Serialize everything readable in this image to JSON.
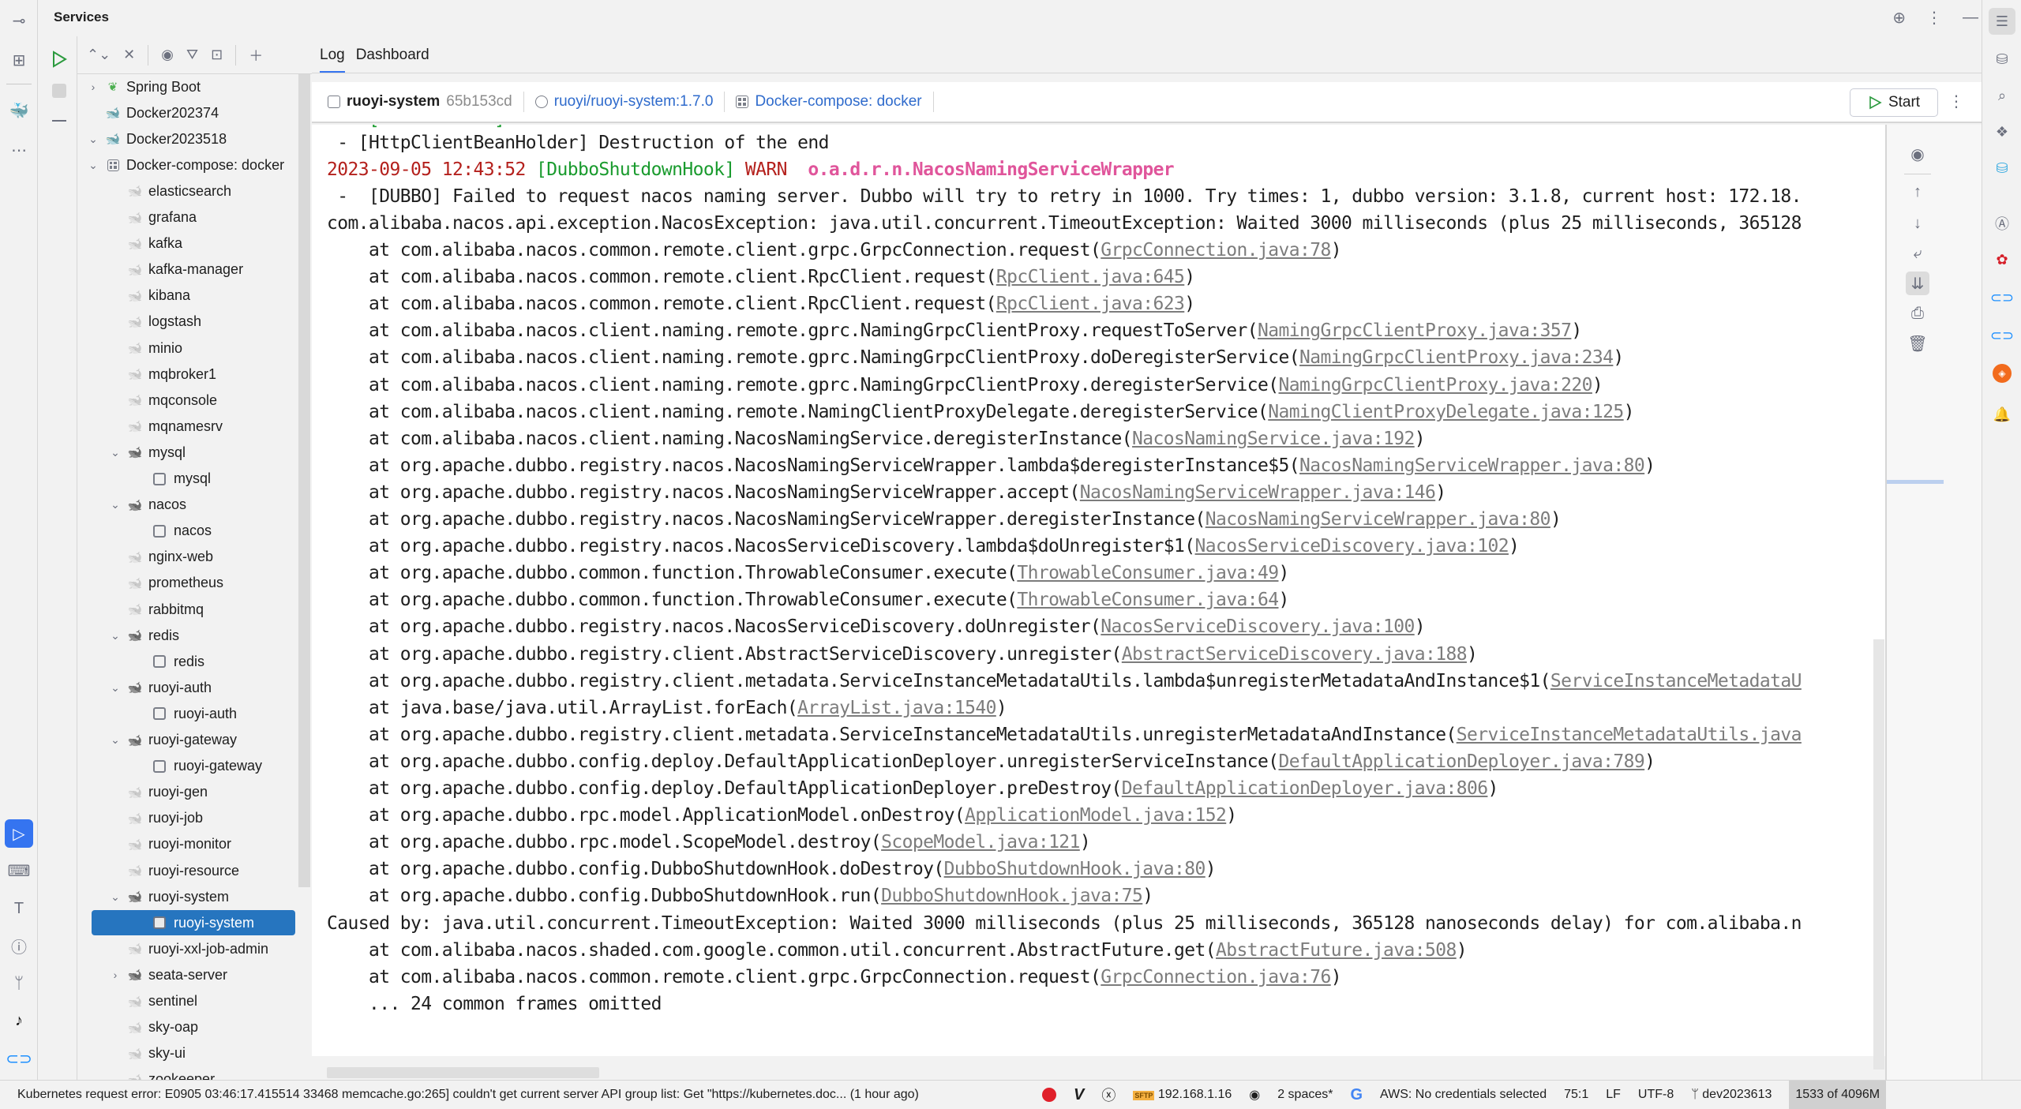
{
  "services": {
    "title": "Services"
  },
  "header_icons": [
    "crosshair-icon",
    "more-icon",
    "minimize-icon"
  ],
  "tree_toolbar": [
    "expand-all-icon",
    "collapse-all-icon",
    "view-options-icon",
    "filter-icon",
    "new-group-icon",
    "add-service-icon"
  ],
  "tree": [
    {
      "label": "Spring Boot",
      "level": 0,
      "chevron": "right",
      "icon": "spring-boot-icon"
    },
    {
      "label": "Docker202374",
      "level": 0,
      "chevron": "",
      "icon": "docker-icon"
    },
    {
      "label": "Docker2023518",
      "level": 0,
      "chevron": "down",
      "icon": "docker-connected-icon"
    },
    {
      "label": "Docker-compose: docker",
      "level": 1,
      "chevron": "down",
      "icon": "compose-icon"
    },
    {
      "label": "elasticsearch",
      "level": 2,
      "chevron": "",
      "icon": "container-idle-icon"
    },
    {
      "label": "grafana",
      "level": 2,
      "chevron": "",
      "icon": "container-idle-icon"
    },
    {
      "label": "kafka",
      "level": 2,
      "chevron": "",
      "icon": "container-idle-icon"
    },
    {
      "label": "kafka-manager",
      "level": 2,
      "chevron": "",
      "icon": "container-idle-icon"
    },
    {
      "label": "kibana",
      "level": 2,
      "chevron": "",
      "icon": "container-idle-icon"
    },
    {
      "label": "logstash",
      "level": 2,
      "chevron": "",
      "icon": "container-idle-icon"
    },
    {
      "label": "minio",
      "level": 2,
      "chevron": "",
      "icon": "container-idle-icon"
    },
    {
      "label": "mqbroker1",
      "level": 2,
      "chevron": "",
      "icon": "container-idle-icon"
    },
    {
      "label": "mqconsole",
      "level": 2,
      "chevron": "",
      "icon": "container-idle-icon"
    },
    {
      "label": "mqnamesrv",
      "level": 2,
      "chevron": "",
      "icon": "container-idle-icon"
    },
    {
      "label": "mysql",
      "level": 2,
      "chevron": "down",
      "icon": "container-service-icon"
    },
    {
      "label": "mysql",
      "level": 3,
      "chevron": "",
      "icon": "container-box-icon"
    },
    {
      "label": "nacos",
      "level": 2,
      "chevron": "down",
      "icon": "container-service-icon"
    },
    {
      "label": "nacos",
      "level": 3,
      "chevron": "",
      "icon": "container-box-icon"
    },
    {
      "label": "nginx-web",
      "level": 2,
      "chevron": "",
      "icon": "container-idle-icon"
    },
    {
      "label": "prometheus",
      "level": 2,
      "chevron": "",
      "icon": "container-idle-icon"
    },
    {
      "label": "rabbitmq",
      "level": 2,
      "chevron": "",
      "icon": "container-idle-icon"
    },
    {
      "label": "redis",
      "level": 2,
      "chevron": "down",
      "icon": "container-service-icon"
    },
    {
      "label": "redis",
      "level": 3,
      "chevron": "",
      "icon": "container-box-icon"
    },
    {
      "label": "ruoyi-auth",
      "level": 2,
      "chevron": "down",
      "icon": "container-service-icon"
    },
    {
      "label": "ruoyi-auth",
      "level": 3,
      "chevron": "",
      "icon": "container-box-icon"
    },
    {
      "label": "ruoyi-gateway",
      "level": 2,
      "chevron": "down",
      "icon": "container-service-icon"
    },
    {
      "label": "ruoyi-gateway",
      "level": 3,
      "chevron": "",
      "icon": "container-box-icon"
    },
    {
      "label": "ruoyi-gen",
      "level": 2,
      "chevron": "",
      "icon": "container-idle-icon"
    },
    {
      "label": "ruoyi-job",
      "level": 2,
      "chevron": "",
      "icon": "container-idle-icon"
    },
    {
      "label": "ruoyi-monitor",
      "level": 2,
      "chevron": "",
      "icon": "container-idle-icon"
    },
    {
      "label": "ruoyi-resource",
      "level": 2,
      "chevron": "",
      "icon": "container-idle-icon"
    },
    {
      "label": "ruoyi-system",
      "level": 2,
      "chevron": "down",
      "icon": "container-service-icon"
    },
    {
      "label": "ruoyi-system",
      "level": 3,
      "chevron": "",
      "icon": "container-box-icon",
      "selected": true
    },
    {
      "label": "ruoyi-xxl-job-admin",
      "level": 2,
      "chevron": "",
      "icon": "container-idle-icon"
    },
    {
      "label": "seata-server",
      "level": 2,
      "chevron": "right",
      "icon": "container-service-icon"
    },
    {
      "label": "sentinel",
      "level": 2,
      "chevron": "",
      "icon": "container-idle-icon"
    },
    {
      "label": "sky-oap",
      "level": 2,
      "chevron": "",
      "icon": "container-idle-icon"
    },
    {
      "label": "sky-ui",
      "level": 2,
      "chevron": "",
      "icon": "container-idle-icon"
    },
    {
      "label": "zookeeper",
      "level": 2,
      "chevron": "",
      "icon": "container-idle-icon"
    }
  ],
  "tabs": [
    {
      "label": "Log",
      "active": true
    },
    {
      "label": "Dashboard",
      "active": false
    }
  ],
  "container_header": {
    "name": "ruoyi-system",
    "id": "65b153cd",
    "image": "ruoyi/ruoyi-system:1.7.0",
    "compose": "Docker-compose: docker",
    "start_label": "Start"
  },
  "log": {
    "top_fragment": " - [HttpClientBeanHolder] Destruction of the end",
    "warn_line": {
      "timestamp": "2023-09-05 12:43:52",
      "thread": "[DubboShutdownHook]",
      "level": "WARN",
      "logger": "o.a.d.r.n.NacosNamingServiceWrapper"
    },
    "message": " -  [DUBBO] Failed to request nacos naming server. Dubbo will try to retry in 1000. Try times: 1, dubbo version: 3.1.8, current host: 172.18.",
    "exception": "com.alibaba.nacos.api.exception.NacosException: java.util.concurrent.TimeoutException: Waited 3000 milliseconds (plus 25 milliseconds, 365128",
    "frames": [
      {
        "text": "    at com.alibaba.nacos.common.remote.client.grpc.GrpcConnection.request(",
        "link": "GrpcConnection.java:78",
        "tail": ")"
      },
      {
        "text": "    at com.alibaba.nacos.common.remote.client.RpcClient.request(",
        "link": "RpcClient.java:645",
        "tail": ")"
      },
      {
        "text": "    at com.alibaba.nacos.common.remote.client.RpcClient.request(",
        "link": "RpcClient.java:623",
        "tail": ")"
      },
      {
        "text": "    at com.alibaba.nacos.client.naming.remote.gprc.NamingGrpcClientProxy.requestToServer(",
        "link": "NamingGrpcClientProxy.java:357",
        "tail": ")"
      },
      {
        "text": "    at com.alibaba.nacos.client.naming.remote.gprc.NamingGrpcClientProxy.doDeregisterService(",
        "link": "NamingGrpcClientProxy.java:234",
        "tail": ")"
      },
      {
        "text": "    at com.alibaba.nacos.client.naming.remote.gprc.NamingGrpcClientProxy.deregisterService(",
        "link": "NamingGrpcClientProxy.java:220",
        "tail": ")"
      },
      {
        "text": "    at com.alibaba.nacos.client.naming.remote.NamingClientProxyDelegate.deregisterService(",
        "link": "NamingClientProxyDelegate.java:125",
        "tail": ")"
      },
      {
        "text": "    at com.alibaba.nacos.client.naming.NacosNamingService.deregisterInstance(",
        "link": "NacosNamingService.java:192",
        "tail": ")"
      },
      {
        "text": "    at org.apache.dubbo.registry.nacos.NacosNamingServiceWrapper.lambda$deregisterInstance$5(",
        "link": "NacosNamingServiceWrapper.java:80",
        "tail": ")"
      },
      {
        "text": "    at org.apache.dubbo.registry.nacos.NacosNamingServiceWrapper.accept(",
        "link": "NacosNamingServiceWrapper.java:146",
        "tail": ")"
      },
      {
        "text": "    at org.apache.dubbo.registry.nacos.NacosNamingServiceWrapper.deregisterInstance(",
        "link": "NacosNamingServiceWrapper.java:80",
        "tail": ")"
      },
      {
        "text": "    at org.apache.dubbo.registry.nacos.NacosServiceDiscovery.lambda$doUnregister$1(",
        "link": "NacosServiceDiscovery.java:102",
        "tail": ")"
      },
      {
        "text": "    at org.apache.dubbo.common.function.ThrowableConsumer.execute(",
        "link": "ThrowableConsumer.java:49",
        "tail": ")"
      },
      {
        "text": "    at org.apache.dubbo.common.function.ThrowableConsumer.execute(",
        "link": "ThrowableConsumer.java:64",
        "tail": ")"
      },
      {
        "text": "    at org.apache.dubbo.registry.nacos.NacosServiceDiscovery.doUnregister(",
        "link": "NacosServiceDiscovery.java:100",
        "tail": ")"
      },
      {
        "text": "    at org.apache.dubbo.registry.client.AbstractServiceDiscovery.unregister(",
        "link": "AbstractServiceDiscovery.java:188",
        "tail": ")"
      },
      {
        "text": "    at org.apache.dubbo.registry.client.metadata.ServiceInstanceMetadataUtils.lambda$unregisterMetadataAndInstance$1(",
        "link": "ServiceInstanceMetadataU",
        "tail": ""
      },
      {
        "text": "    at java.base/java.util.ArrayList.forEach(",
        "link": "ArrayList.java:1540",
        "tail": ")"
      },
      {
        "text": "    at org.apache.dubbo.registry.client.metadata.ServiceInstanceMetadataUtils.unregisterMetadataAndInstance(",
        "link": "ServiceInstanceMetadataUtils.java",
        "tail": ""
      },
      {
        "text": "    at org.apache.dubbo.config.deploy.DefaultApplicationDeployer.unregisterServiceInstance(",
        "link": "DefaultApplicationDeployer.java:789",
        "tail": ")"
      },
      {
        "text": "    at org.apache.dubbo.config.deploy.DefaultApplicationDeployer.preDestroy(",
        "link": "DefaultApplicationDeployer.java:806",
        "tail": ")"
      },
      {
        "text": "    at org.apache.dubbo.rpc.model.ApplicationModel.onDestroy(",
        "link": "ApplicationModel.java:152",
        "tail": ")"
      },
      {
        "text": "    at org.apache.dubbo.rpc.model.ScopeModel.destroy(",
        "link": "ScopeModel.java:121",
        "tail": ")"
      },
      {
        "text": "    at org.apache.dubbo.config.DubboShutdownHook.doDestroy(",
        "link": "DubboShutdownHook.java:80",
        "tail": ")"
      },
      {
        "text": "    at org.apache.dubbo.config.DubboShutdownHook.run(",
        "link": "DubboShutdownHook.java:75",
        "tail": ")"
      }
    ],
    "caused_by": "Caused by: java.util.concurrent.TimeoutException: Waited 3000 milliseconds (plus 25 milliseconds, 365128 nanoseconds delay) for com.alibaba.n",
    "cause_frames": [
      {
        "text": "    at com.alibaba.nacos.shaded.com.google.common.util.concurrent.AbstractFuture.get(",
        "link": "AbstractFuture.java:508",
        "tail": ")"
      },
      {
        "text": "    at com.alibaba.nacos.common.remote.client.grpc.GrpcConnection.request(",
        "link": "GrpcConnection.java:76",
        "tail": ")"
      }
    ],
    "omitted": "    ... 24 common frames omitted"
  },
  "log_tools": [
    "view-icon",
    "scroll-up-icon",
    "scroll-down-icon",
    "soft-wrap-icon",
    "scroll-to-end-icon",
    "print-icon",
    "clear-icon"
  ],
  "status_bar": {
    "message": "Kubernetes request error: E0905 03:46:17.415514   33468 memcache.go:265] couldn't get current server API group list: Get \"https://kubernetes.doc... (1 hour ago)",
    "sftp_host": "192.168.1.16",
    "indent": "2 spaces*",
    "aws": "AWS: No credentials selected",
    "position": "75:1",
    "line_sep": "LF",
    "encoding": "UTF-8",
    "branch": "dev2023613",
    "memory": "1533 of 4096M"
  }
}
